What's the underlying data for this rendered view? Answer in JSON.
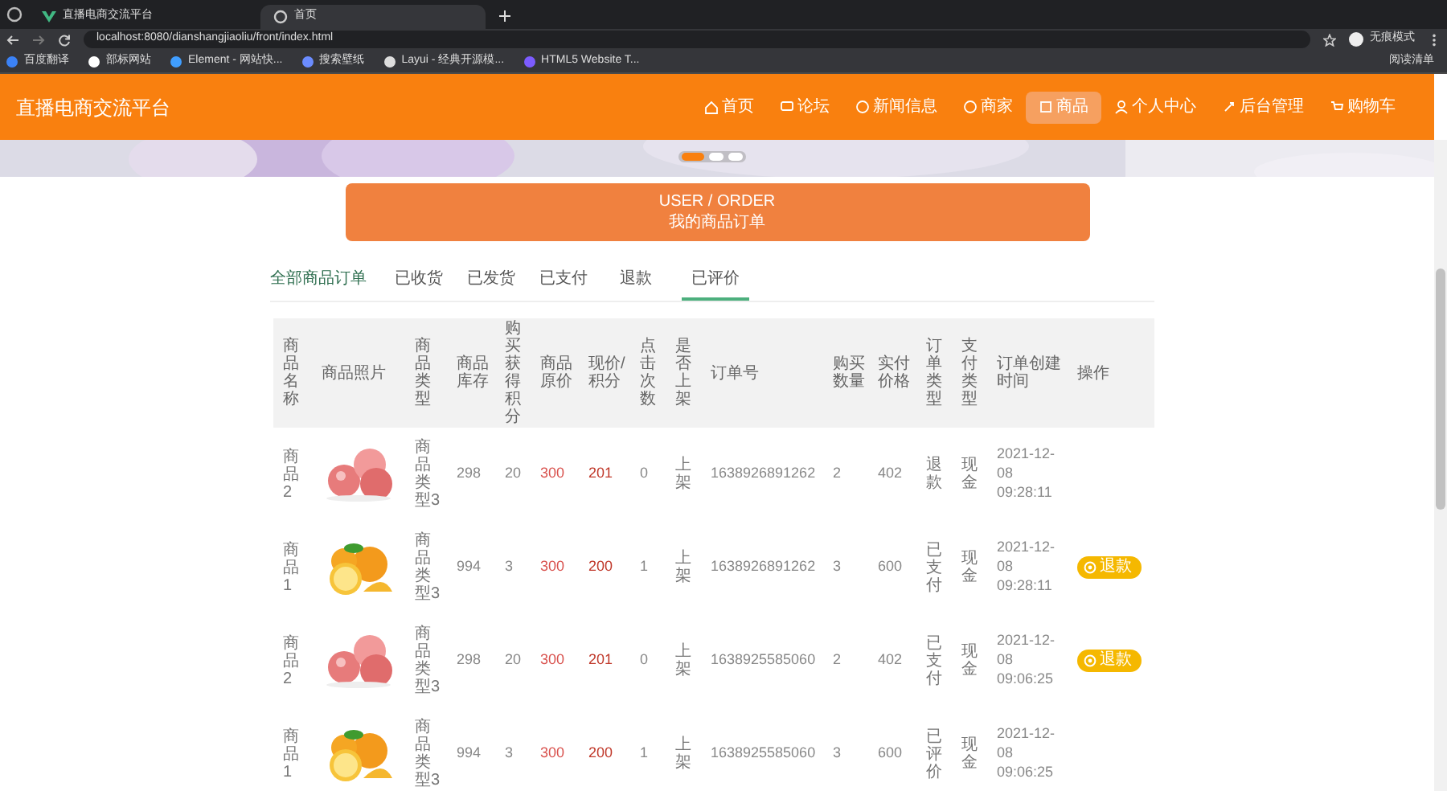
{
  "browser": {
    "tabs": [
      {
        "title": "直播电商交流平台",
        "selected": false
      },
      {
        "title": "首页",
        "selected": true
      }
    ],
    "address": "localhost:8080/dianshangjiaoliu/front/index.html",
    "profile": "无痕模式",
    "bookmarks": [
      "百度翻译",
      "部标网站",
      "Element - 网站快...",
      "搜索壁纸",
      "Layui - 经典开源模...",
      "HTML5 Website T..."
    ],
    "reading_list": "阅读清单"
  },
  "site": {
    "logo": "直播电商交流平台",
    "nav": [
      {
        "label": "首页",
        "selected": false
      },
      {
        "label": "论坛",
        "selected": false
      },
      {
        "label": "新闻信息",
        "selected": false
      },
      {
        "label": "商家",
        "selected": false
      },
      {
        "label": "商品",
        "selected": true
      },
      {
        "label": "个人中心",
        "selected": false
      },
      {
        "label": "后台管理",
        "selected": false
      },
      {
        "label": "购物车",
        "selected": false
      }
    ],
    "banner_dots": [
      {
        "selected": true
      },
      {
        "selected": false
      },
      {
        "selected": false
      }
    ]
  },
  "title_card": {
    "en": "USER / ORDER",
    "zh": "我的商品订单"
  },
  "order_tabs": [
    {
      "label": "全部商品订单",
      "selected": false
    },
    {
      "label": "已收货",
      "selected": false
    },
    {
      "label": "已发货",
      "selected": false
    },
    {
      "label": "已支付",
      "selected": false
    },
    {
      "label": "退款",
      "selected": false
    },
    {
      "label": "已评价",
      "selected": true
    }
  ],
  "table": {
    "columns": [
      "商品名称",
      "商品照片",
      "商品类型",
      "商品库存",
      "购买获得积分",
      "商品原价",
      "现价/积分",
      "点击次数",
      "是否上架",
      "订单号",
      "购买数量",
      "实付价格",
      "订单类型",
      "支付类型",
      "订单创建时间",
      "操作"
    ],
    "rows": [
      {
        "name": "商品2",
        "type": "商品类型3",
        "stock": "298",
        "points": "20",
        "price": "300",
        "now_price": "201",
        "clicks": "0",
        "on_shelf": "上架",
        "order_no": "1638926891262",
        "qty": "2",
        "paid": "402",
        "order_type": "退款",
        "pay_type": "现金",
        "created": "2021-12-08 09:28:11"
      },
      {
        "name": "商品1",
        "type": "商品类型3",
        "stock": "994",
        "points": "3",
        "price": "300",
        "now_price": "200",
        "clicks": "1",
        "on_shelf": "上架",
        "order_no": "1638926891262",
        "qty": "3",
        "paid": "600",
        "order_type": "已支付",
        "pay_type": "现金",
        "created": "2021-12-08 09:28:11",
        "action": "退款"
      },
      {
        "name": "商品2",
        "type": "商品类型3",
        "stock": "298",
        "points": "20",
        "price": "300",
        "now_price": "201",
        "clicks": "0",
        "on_shelf": "上架",
        "order_no": "1638925585060",
        "qty": "2",
        "paid": "402",
        "order_type": "已支付",
        "pay_type": "现金",
        "created": "2021-12-08 09:06:25",
        "action": "退款"
      },
      {
        "name": "商品1",
        "type": "商品类型3",
        "stock": "994",
        "points": "3",
        "price": "300",
        "now_price": "200",
        "clicks": "1",
        "on_shelf": "上架",
        "order_no": "1638925585060",
        "qty": "3",
        "paid": "600",
        "order_type": "已评价",
        "pay_type": "现金",
        "created": "2021-12-08 09:06:25"
      }
    ]
  }
}
